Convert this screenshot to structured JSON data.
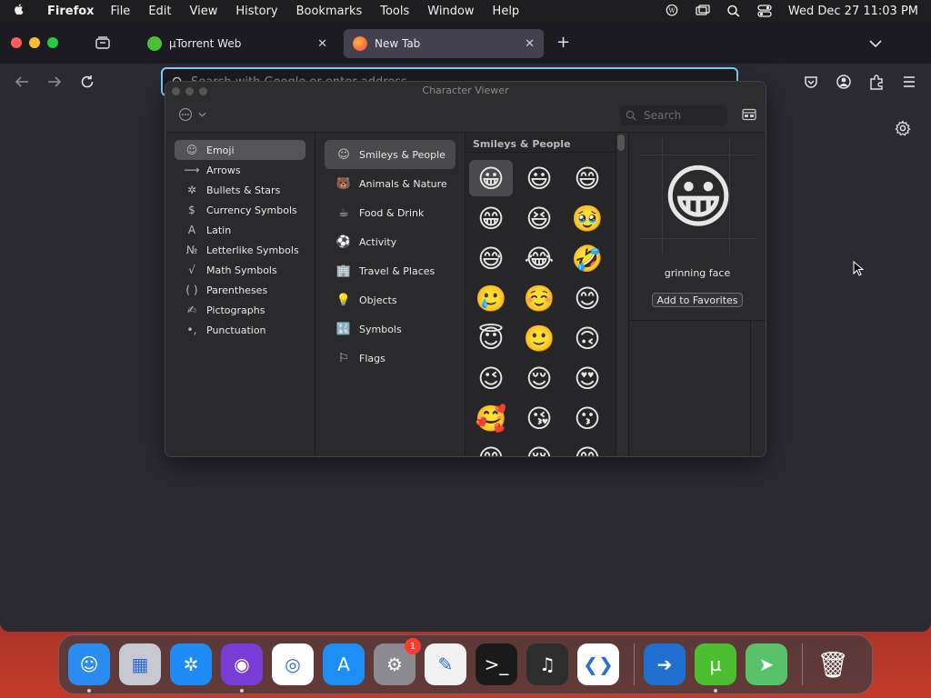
{
  "menubar": {
    "app_name": "Firefox",
    "items": [
      "File",
      "Edit",
      "View",
      "History",
      "Bookmarks",
      "Tools",
      "Window",
      "Help"
    ],
    "clock": "Wed Dec 27  11:03 PM"
  },
  "browser": {
    "tabs": [
      {
        "title": "µTorrent Web",
        "favicon": "utorrent-icon",
        "active": false
      },
      {
        "title": "New Tab",
        "favicon": "firefox-icon",
        "active": true
      }
    ],
    "urlbar_placeholder": "Search with Google or enter address"
  },
  "character_viewer": {
    "title": "Character Viewer",
    "search_placeholder": "Search",
    "categories": [
      {
        "label": "Emoji",
        "icon": "☺",
        "selected": true
      },
      {
        "label": "Arrows",
        "icon": "⟶",
        "selected": false
      },
      {
        "label": "Bullets & Stars",
        "icon": "✲",
        "selected": false
      },
      {
        "label": "Currency Symbols",
        "icon": "$",
        "selected": false
      },
      {
        "label": "Latin",
        "icon": "A",
        "selected": false
      },
      {
        "label": "Letterlike Symbols",
        "icon": "№",
        "selected": false
      },
      {
        "label": "Math Symbols",
        "icon": "√",
        "selected": false
      },
      {
        "label": "Parentheses",
        "icon": "( )",
        "selected": false
      },
      {
        "label": "Pictographs",
        "icon": "✍",
        "selected": false
      },
      {
        "label": "Punctuation",
        "icon": "•,",
        "selected": false
      }
    ],
    "subcategories": [
      {
        "label": "Smileys & People",
        "icon": "☺",
        "selected": true
      },
      {
        "label": "Animals & Nature",
        "icon": "🐻",
        "selected": false
      },
      {
        "label": "Food & Drink",
        "icon": "☕",
        "selected": false
      },
      {
        "label": "Activity",
        "icon": "⚽",
        "selected": false
      },
      {
        "label": "Travel & Places",
        "icon": "🏢",
        "selected": false
      },
      {
        "label": "Objects",
        "icon": "💡",
        "selected": false
      },
      {
        "label": "Symbols",
        "icon": "🔣",
        "selected": false
      },
      {
        "label": "Flags",
        "icon": "⚐",
        "selected": false
      }
    ],
    "grid_header": "Smileys & People",
    "emojis": [
      "😀",
      "😃",
      "😄",
      "😁",
      "😆",
      "🥹",
      "😅",
      "😂",
      "🤣",
      "🥲",
      "☺️",
      "😊",
      "😇",
      "🙂",
      "🙃",
      "😉",
      "😌",
      "😍",
      "🥰",
      "😘",
      "😗",
      "😙",
      "😚",
      "😋"
    ],
    "selected_emoji": "😀",
    "selected_name": "grinning face",
    "favorites_button": "Add to Favorites"
  },
  "dock": {
    "apps": [
      {
        "name": "finder-icon",
        "label": "Finder",
        "glyph": "☺",
        "bg": "#2a8cf0",
        "running": true,
        "badge": ""
      },
      {
        "name": "launchpad-icon",
        "label": "Launchpad",
        "glyph": "▦",
        "bg": "#c8c8d0",
        "running": false,
        "badge": ""
      },
      {
        "name": "safari-icon",
        "label": "Safari",
        "glyph": "✲",
        "bg": "#1f8cf5",
        "running": false,
        "badge": ""
      },
      {
        "name": "firefox-icon",
        "label": "Firefox",
        "glyph": "◉",
        "bg": "#7a3cd6",
        "running": true,
        "badge": ""
      },
      {
        "name": "chrome-icon",
        "label": "Chrome",
        "glyph": "◎",
        "bg": "#ffffff",
        "running": false,
        "badge": ""
      },
      {
        "name": "app-store-icon",
        "label": "App Store",
        "glyph": "A",
        "bg": "#1c8ef5",
        "running": false,
        "badge": ""
      },
      {
        "name": "system-settings-icon",
        "label": "System Settings",
        "glyph": "⚙",
        "bg": "#8a8a90",
        "running": false,
        "badge": "1"
      },
      {
        "name": "textedit-icon",
        "label": "TextEdit",
        "glyph": "✎",
        "bg": "#f1f1f1",
        "running": false,
        "badge": ""
      },
      {
        "name": "terminal-icon",
        "label": "Terminal",
        "glyph": ">_",
        "bg": "#1a1a1a",
        "running": false,
        "badge": ""
      },
      {
        "name": "garageband-icon",
        "label": "GarageBand",
        "glyph": "♫",
        "bg": "#2d2d2d",
        "running": false,
        "badge": ""
      },
      {
        "name": "vscode-icon",
        "label": "VS Code",
        "glyph": "❮❯",
        "bg": "#ffffff",
        "running": false,
        "badge": ""
      }
    ],
    "recent_apps": [
      {
        "name": "migration-assistant-icon",
        "label": "Migration",
        "glyph": "➔",
        "bg": "#1f6fd0",
        "running": false,
        "badge": ""
      },
      {
        "name": "utorrent-dock-icon",
        "label": "µTorrent",
        "glyph": "µ",
        "bg": "#4bbf2f",
        "running": true,
        "badge": ""
      },
      {
        "name": "maps-icon",
        "label": "Maps",
        "glyph": "➤",
        "bg": "#58c26b",
        "running": false,
        "badge": ""
      }
    ],
    "trash": {
      "name": "trash-icon",
      "label": "Trash",
      "glyph": "🗑",
      "bg": "transparent"
    }
  },
  "colors": {
    "accent": "#7fd0f0",
    "tab_active": "#42414d",
    "window_bg": "#2b2a33"
  }
}
